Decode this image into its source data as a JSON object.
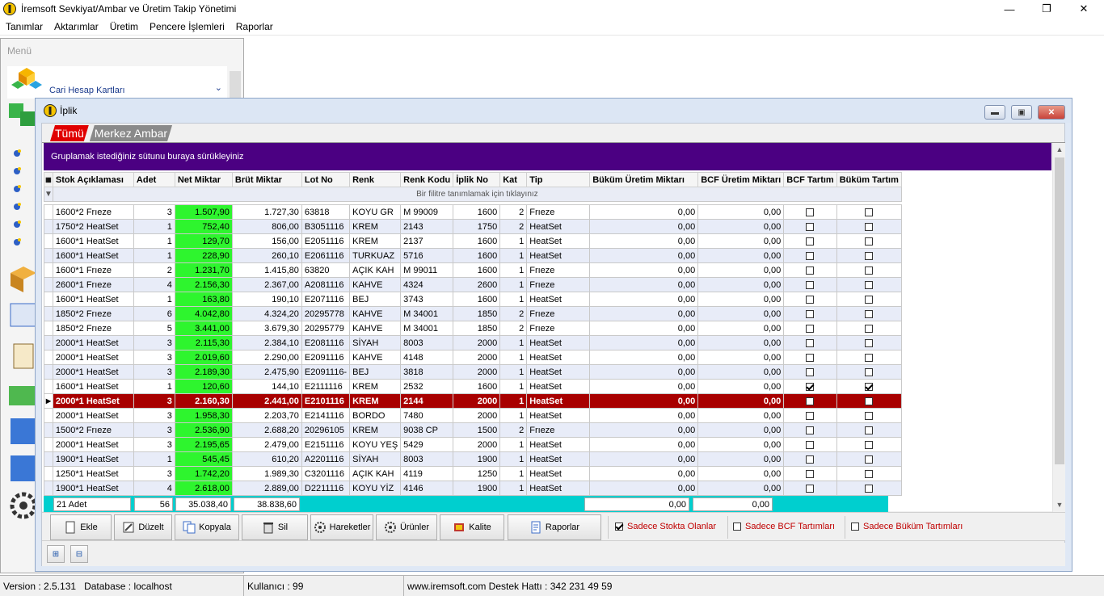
{
  "app": {
    "title": "İremsoft Sevkiyat/Ambar ve Üretim Takip Yönetimi",
    "minimize": "—",
    "maximize": "❐",
    "close": "✕"
  },
  "menubar": [
    "Tanımlar",
    "Aktarımlar",
    "Üretim",
    "Pencere İşlemleri",
    "Raporlar"
  ],
  "left_panel": {
    "header": "Menü",
    "selected_group": "Cari Hesap Kartları"
  },
  "child_window": {
    "title": "İplik",
    "tabs": [
      "Tümü",
      "Merkez Ambar"
    ],
    "active_tab": "Tümü"
  },
  "grid": {
    "group_hint": "Gruplamak istediğiniz sütunu buraya sürükleyiniz",
    "filter_hint": "Bir filitre tanımlamak için tıklayınız",
    "columns": [
      "Stok Açıklaması",
      "Adet",
      "Net Miktar",
      "Brüt Miktar",
      "Lot No",
      "Renk",
      "Renk Kodu",
      "İplik No",
      "Kat",
      "Tip",
      "Büküm Üretim Miktarı",
      "BCF Üretim Miktarı",
      "BCF Tartım",
      "Büküm Tartım"
    ],
    "rows": [
      [
        "1600*2 Frıeze",
        "3",
        "1.507,90",
        "1.727,30",
        "63818",
        "KOYU GR",
        "M 99009",
        "1600",
        "2",
        "Frıeze",
        "0,00",
        "0,00",
        false,
        false
      ],
      [
        "1750*2 HeatSet",
        "1",
        "752,40",
        "806,00",
        "B3051116",
        "KREM",
        "2143",
        "1750",
        "2",
        "HeatSet",
        "0,00",
        "0,00",
        false,
        false
      ],
      [
        "1600*1 HeatSet",
        "1",
        "129,70",
        "156,00",
        "E2051116",
        "KREM",
        "2137",
        "1600",
        "1",
        "HeatSet",
        "0,00",
        "0,00",
        false,
        false
      ],
      [
        "1600*1 HeatSet",
        "1",
        "228,90",
        "260,10",
        "E2061116",
        "TURKUAZ",
        "5716",
        "1600",
        "1",
        "HeatSet",
        "0,00",
        "0,00",
        false,
        false
      ],
      [
        "1600*1 Frıeze",
        "2",
        "1.231,70",
        "1.415,80",
        "63820",
        "AÇIK KAH",
        "M 99011",
        "1600",
        "1",
        "Frıeze",
        "0,00",
        "0,00",
        false,
        false
      ],
      [
        "2600*1 Frıeze",
        "4",
        "2.156,30",
        "2.367,00",
        "A2081116",
        "KAHVE",
        "4324",
        "2600",
        "1",
        "Frıeze",
        "0,00",
        "0,00",
        false,
        false
      ],
      [
        "1600*1 HeatSet",
        "1",
        "163,80",
        "190,10",
        "E2071116",
        "BEJ",
        "3743",
        "1600",
        "1",
        "HeatSet",
        "0,00",
        "0,00",
        false,
        false
      ],
      [
        "1850*2 Frıeze",
        "6",
        "4.042,80",
        "4.324,20",
        "20295778",
        "KAHVE",
        "M 34001",
        "1850",
        "2",
        "Frıeze",
        "0,00",
        "0,00",
        false,
        false
      ],
      [
        "1850*2 Frıeze",
        "5",
        "3.441,00",
        "3.679,30",
        "20295779",
        "KAHVE",
        "M 34001",
        "1850",
        "2",
        "Frıeze",
        "0,00",
        "0,00",
        false,
        false
      ],
      [
        "2000*1 HeatSet",
        "3",
        "2.115,30",
        "2.384,10",
        "E2081116",
        "SİYAH",
        "8003",
        "2000",
        "1",
        "HeatSet",
        "0,00",
        "0,00",
        false,
        false
      ],
      [
        "2000*1 HeatSet",
        "3",
        "2.019,60",
        "2.290,00",
        "E2091116",
        "KAHVE",
        "4148",
        "2000",
        "1",
        "HeatSet",
        "0,00",
        "0,00",
        false,
        false
      ],
      [
        "2000*1 HeatSet",
        "3",
        "2.189,30",
        "2.475,90",
        "E2091116-",
        "BEJ",
        "3818",
        "2000",
        "1",
        "HeatSet",
        "0,00",
        "0,00",
        false,
        false
      ],
      [
        "1600*1 HeatSet",
        "1",
        "120,60",
        "144,10",
        "E2111116",
        "KREM",
        "2532",
        "1600",
        "1",
        "HeatSet",
        "0,00",
        "0,00",
        true,
        true
      ],
      [
        "2000*1 HeatSet",
        "3",
        "2.160,30",
        "2.441,00",
        "E2101116",
        "KREM",
        "2144",
        "2000",
        "1",
        "HeatSet",
        "0,00",
        "0,00",
        false,
        false
      ],
      [
        "2000*1 HeatSet",
        "3",
        "1.958,30",
        "2.203,70",
        "E2141116",
        "BORDO",
        "7480",
        "2000",
        "1",
        "HeatSet",
        "0,00",
        "0,00",
        false,
        false
      ],
      [
        "1500*2 Frıeze",
        "3",
        "2.536,90",
        "2.688,20",
        "20296105",
        "KREM",
        "9038 CP",
        "1500",
        "2",
        "Frıeze",
        "0,00",
        "0,00",
        false,
        false
      ],
      [
        "2000*1 HeatSet",
        "3",
        "2.195,65",
        "2.479,00",
        "E2151116",
        "KOYU YEŞ",
        "5429",
        "2000",
        "1",
        "HeatSet",
        "0,00",
        "0,00",
        false,
        false
      ],
      [
        "1900*1 HeatSet",
        "1",
        "545,45",
        "610,20",
        "A2201116",
        "SİYAH",
        "8003",
        "1900",
        "1",
        "HeatSet",
        "0,00",
        "0,00",
        false,
        false
      ],
      [
        "1250*1 HeatSet",
        "3",
        "1.742,20",
        "1.989,30",
        "C3201116",
        "AÇIK KAH",
        "4119",
        "1250",
        "1",
        "HeatSet",
        "0,00",
        "0,00",
        false,
        false
      ],
      [
        "1900*1 HeatSet",
        "4",
        "2.618,00",
        "2.889,00",
        "D2211116",
        "KOYU YİZ",
        "4146",
        "1900",
        "1",
        "HeatSet",
        "0,00",
        "0,00",
        false,
        false
      ]
    ],
    "selected_row": 13,
    "footer": {
      "count": "21 Adet",
      "adet": "56",
      "net": "35.038,40",
      "brut": "38.838,60",
      "bukum": "0,00",
      "bcf": "0,00"
    }
  },
  "buttons": {
    "ekle": "Ekle",
    "duzelt": "Düzelt",
    "kopyala": "Kopyala",
    "sil": "Sil",
    "hareketler": "Hareketler",
    "urunler": "Ürünler",
    "kalite": "Kalite",
    "raporlar": "Raporlar"
  },
  "checks": {
    "stokta": {
      "label": "Sadece Stokta Olanlar",
      "checked": true
    },
    "bcf": {
      "label": "Sadece BCF Tartımları",
      "checked": false
    },
    "bukum": {
      "label": "Sadece Büküm Tartımları",
      "checked": false
    }
  },
  "status": {
    "version": "Version : 2.5.131",
    "database": "Database :  localhost",
    "user": "Kullanıcı : 99",
    "web": "www.iremsoft.com  Destek Hattı : 342 231 49 59"
  },
  "colors": {
    "group_bar": "#4b0082",
    "net_highlight": "#2ef52e",
    "selected_row": "#a80000",
    "footer": "#00cfcf",
    "tab_active": "#e00000"
  }
}
